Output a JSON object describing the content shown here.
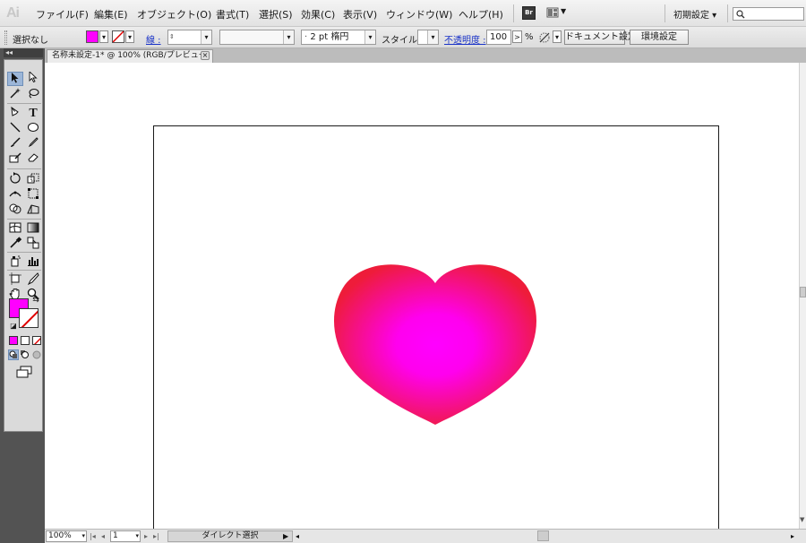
{
  "app": {
    "logo": "Ai"
  },
  "menu": [
    {
      "label": "ファイル(F)"
    },
    {
      "label": "編集(E)"
    },
    {
      "label": "オブジェクト(O)"
    },
    {
      "label": "書式(T)"
    },
    {
      "label": "選択(S)"
    },
    {
      "label": "効果(C)"
    },
    {
      "label": "表示(V)"
    },
    {
      "label": "ウィンドウ(W)"
    },
    {
      "label": "ヘルプ(H)"
    }
  ],
  "bridge_button": "Br",
  "workspace": {
    "label": "初期設定 ▾"
  },
  "control_bar": {
    "selection_label": "選択なし",
    "fill_color": "#ff00ff",
    "stroke_link": "線 :",
    "stroke_weight": "",
    "brush_field": "",
    "brush_value": "2 pt 楕円",
    "style_label": "スタイル :",
    "opacity_link": "不透明度 :",
    "opacity_value": "100",
    "opacity_arrow": ">",
    "opacity_unit": "%",
    "document_setup": "ドキュメント設定",
    "preferences": "環境設定"
  },
  "document": {
    "tab_title": "名称未設定-1* @ 100% (RGB/プレビュー)",
    "tab_close": "×"
  },
  "tools_fill_color": "#ff00ff",
  "artwork": {
    "heart_center_color": "#ff00ff",
    "heart_edge_color": "#ee1c3a"
  },
  "status_bar": {
    "zoom": "100%",
    "artboard_number": "1",
    "tool_display": "ダイレクト選択"
  }
}
